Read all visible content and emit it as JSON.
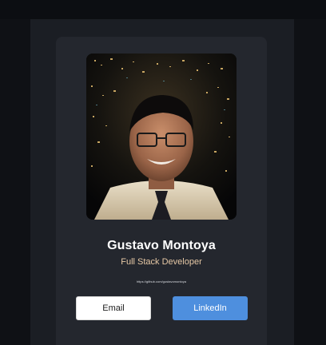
{
  "profile": {
    "name": "Gustavo Montoya",
    "title": "Full Stack Developer",
    "url": "https://github.com/gustavomontoya"
  },
  "actions": {
    "email_label": "Email",
    "linkedin_label": "LinkedIn"
  },
  "colors": {
    "page_background": "#0f1115",
    "panel_background": "#1b1e24",
    "card_background": "#24272e",
    "title_accent": "#e6c8a5",
    "linkedin_button": "#4e8fde",
    "email_button": "#ffffff"
  },
  "icons": [
    "profile-photo"
  ]
}
